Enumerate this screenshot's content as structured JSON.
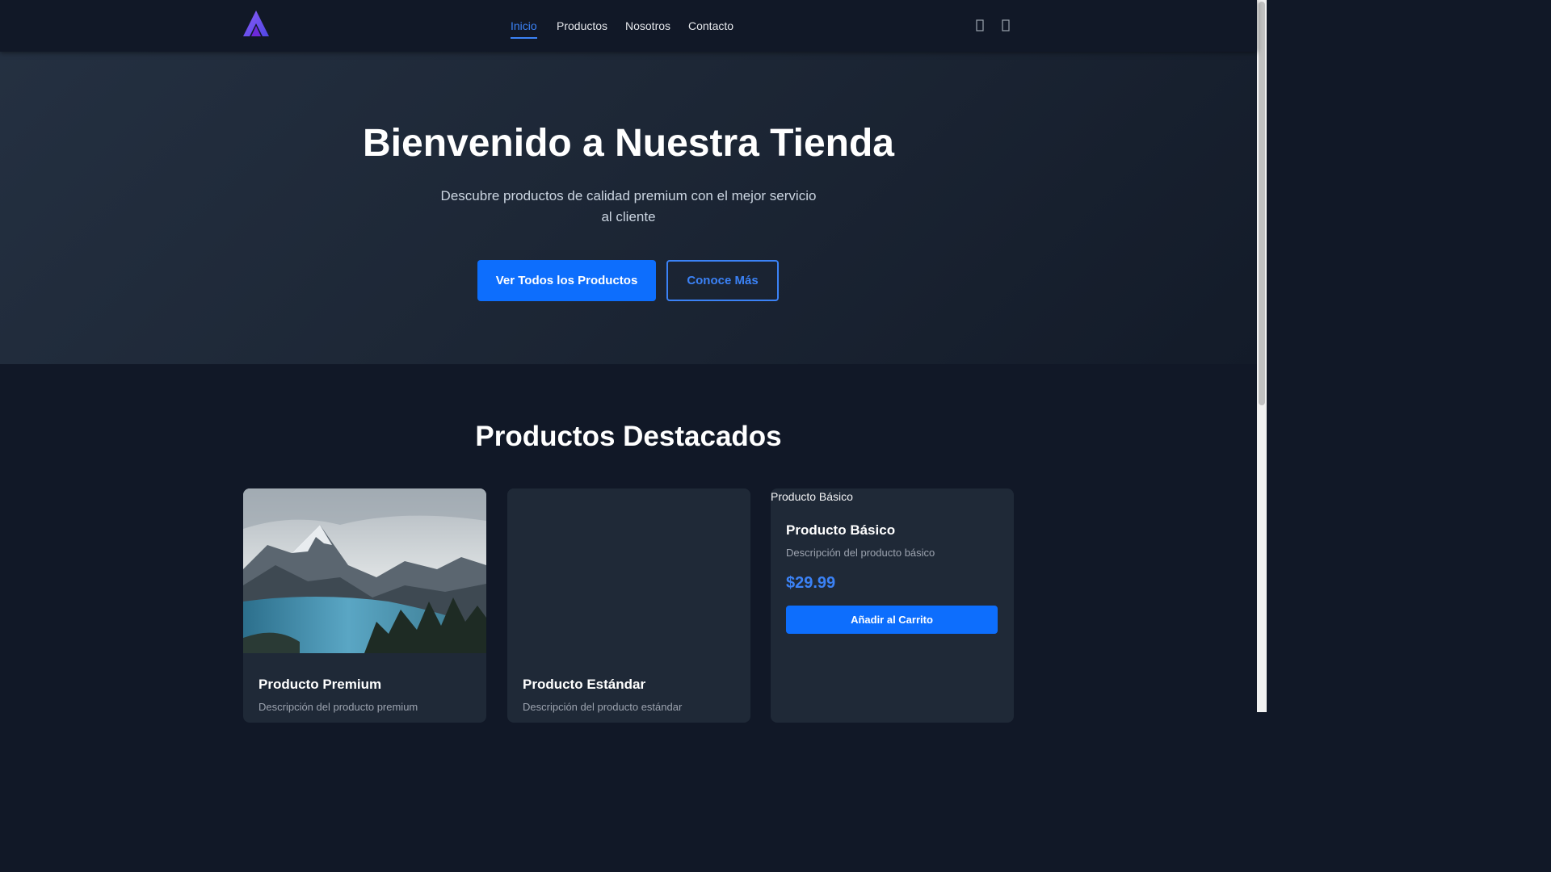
{
  "brand": {
    "logo_icon": "triangle-a-logo",
    "accent_color": "#7c3aed"
  },
  "nav": {
    "items": [
      {
        "label": "Inicio",
        "active": true
      },
      {
        "label": "Productos",
        "active": false
      },
      {
        "label": "Nosotros",
        "active": false
      },
      {
        "label": "Contacto",
        "active": false
      }
    ],
    "icons": [
      "search-icon",
      "cart-icon"
    ],
    "active_color": "#3b82f6"
  },
  "hero": {
    "title": "Bienvenido a Nuestra Tienda",
    "subtitle": "Descubre productos de calidad premium con el mejor servicio al cliente",
    "primary_button": "Ver Todos los Productos",
    "secondary_button": "Conoce Más"
  },
  "featured": {
    "title": "Productos Destacados",
    "products": [
      {
        "name": "Producto Premium",
        "description": "Descripción del producto premium",
        "image": "mountain-lake-photo"
      },
      {
        "name": "Producto Estándar",
        "description": "Descripción del producto estándar",
        "image": "blank-image"
      },
      {
        "name": "Producto Básico",
        "description": "Descripción del producto básico",
        "image_alt": "Producto Básico",
        "price": "$29.99",
        "button": "Añadir al Carrito"
      }
    ]
  },
  "colors": {
    "background": "#111827",
    "card": "#1f2937",
    "primary": "#0d6efd"
  }
}
